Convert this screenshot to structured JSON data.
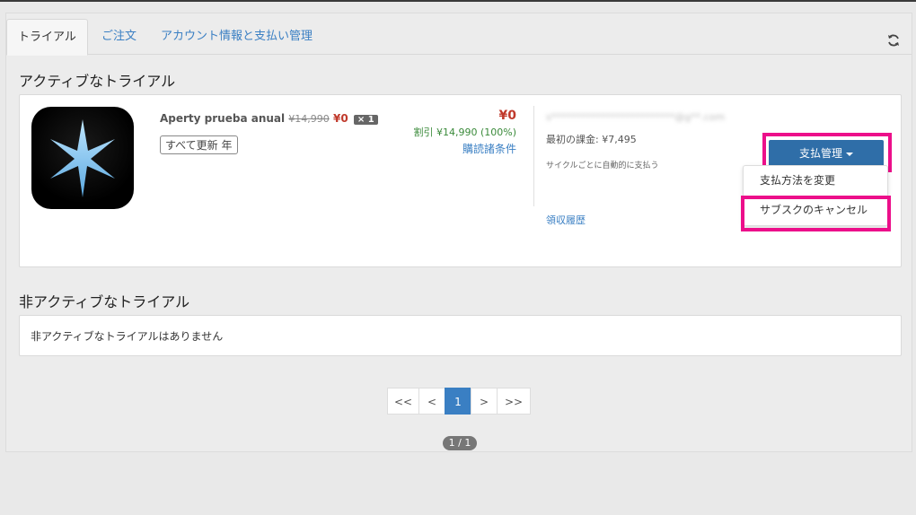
{
  "tabs": [
    {
      "label": "トライアル",
      "active": true
    },
    {
      "label": "ご注文",
      "active": false
    },
    {
      "label": "アカウント情報と支払い管理",
      "active": false
    }
  ],
  "icons": {
    "refresh": "refresh-icon",
    "app": "star-app-icon"
  },
  "active_section": {
    "title": "アクティブなトライアル",
    "item": {
      "product_name": "Aperty prueba anual",
      "original_price": "¥14,990",
      "sale_price": "¥0",
      "quantity": "× 1",
      "renewal_label": "すべて更新 年",
      "total": "¥0",
      "discount": "割引 ¥14,990 (100%)",
      "terms_link": "購読諸条件",
      "email": "s*************************@g**.com",
      "first_charge": "最初の課金: ¥7,495",
      "billing_note": "サイクルごとに自動的に支払う",
      "receipt_link": "領収履歴",
      "manage_button": "支払管理",
      "menu": [
        "支払方法を変更",
        "サブスクのキャンセル"
      ]
    }
  },
  "inactive_section": {
    "title": "非アクティブなトライアル",
    "empty_message": "非アクティブなトライアルはありません"
  },
  "pagination": {
    "buttons": [
      "<<",
      "<",
      "1",
      ">",
      ">>"
    ],
    "current": "1",
    "page_count": "1 / 1"
  },
  "colors": {
    "accent": "#3a7fc3",
    "highlight": "#ec0f8a",
    "price_red": "#c0392b",
    "discount_green": "#3a8a3a"
  }
}
